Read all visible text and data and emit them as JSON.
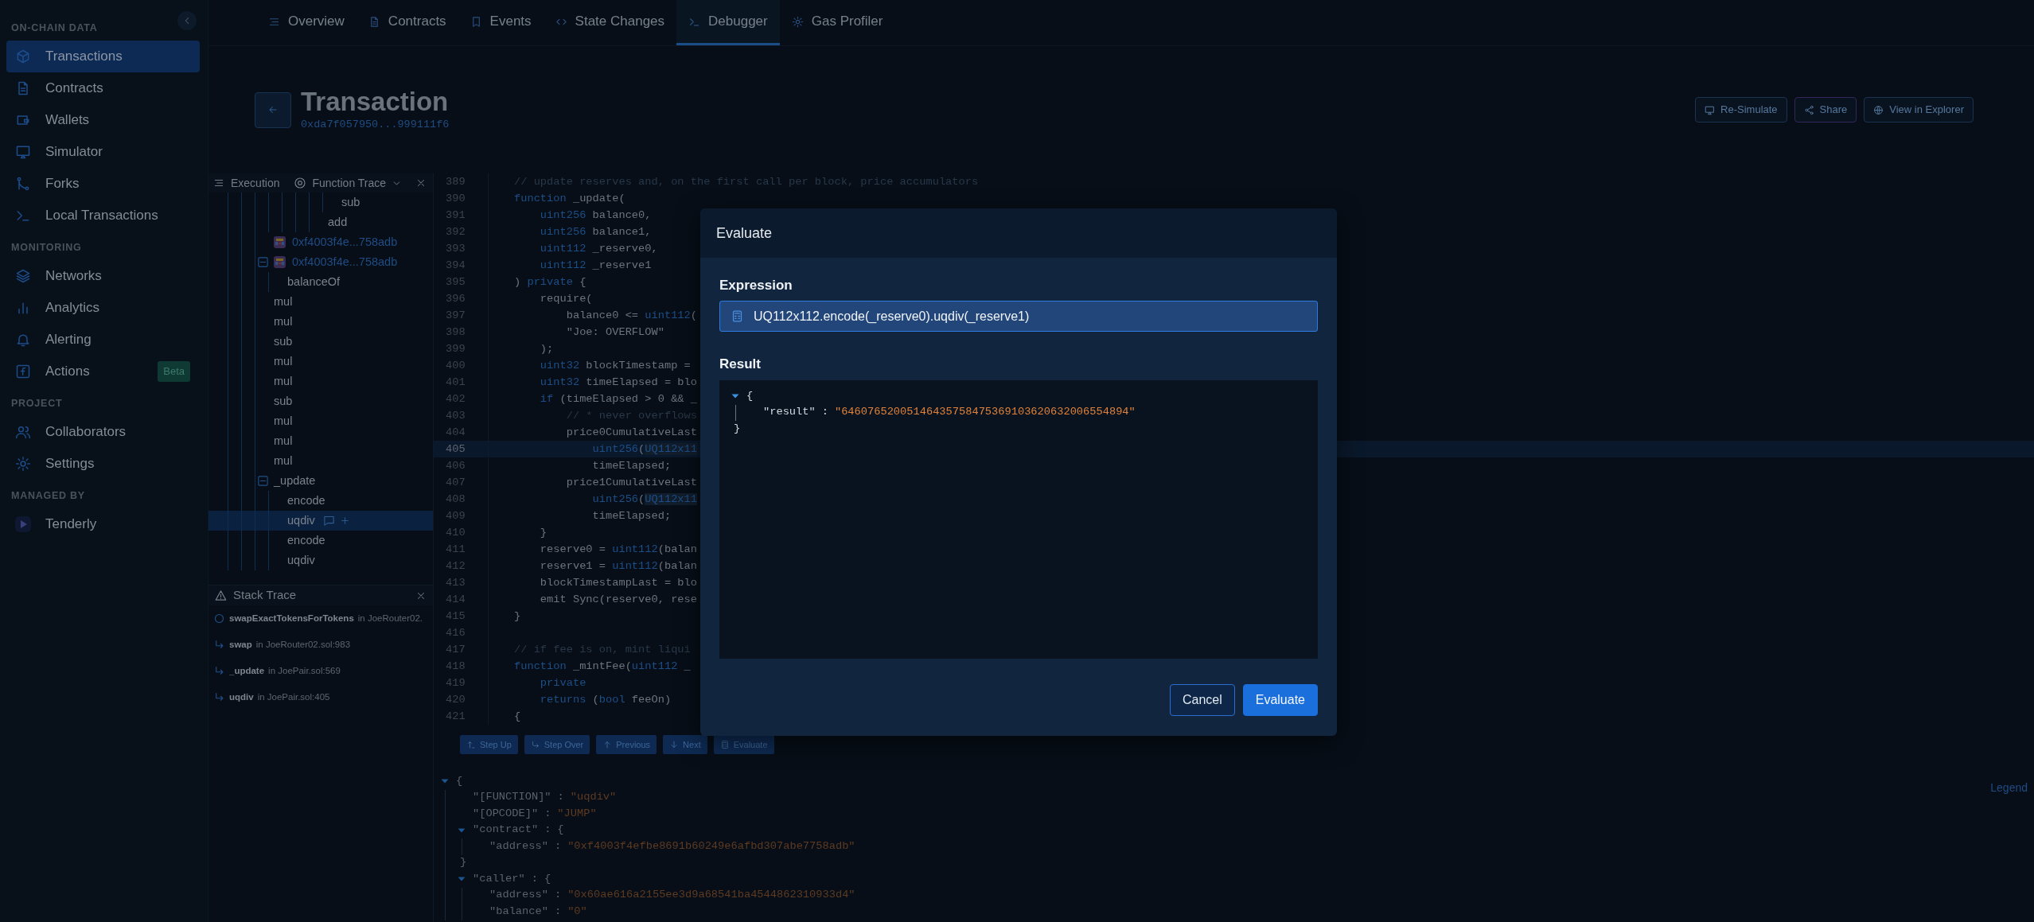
{
  "sidebar": {
    "sections": [
      {
        "title": "ON-CHAIN DATA",
        "items": [
          {
            "label": "Transactions",
            "selected": true
          },
          {
            "label": "Contracts",
            "selected": false
          },
          {
            "label": "Wallets",
            "selected": false
          },
          {
            "label": "Simulator",
            "selected": false
          },
          {
            "label": "Forks",
            "selected": false
          },
          {
            "label": "Local Transactions",
            "selected": false
          }
        ]
      },
      {
        "title": "MONITORING",
        "items": [
          {
            "label": "Networks",
            "selected": false
          },
          {
            "label": "Analytics",
            "selected": false
          },
          {
            "label": "Alerting",
            "selected": false
          },
          {
            "label": "Actions",
            "selected": false,
            "badge": "Beta"
          }
        ]
      },
      {
        "title": "PROJECT",
        "items": [
          {
            "label": "Collaborators",
            "selected": false
          },
          {
            "label": "Settings",
            "selected": false
          }
        ]
      },
      {
        "title": "MANAGED BY",
        "items": [
          {
            "label": "Tenderly",
            "selected": false
          }
        ]
      }
    ]
  },
  "tabs": [
    {
      "label": "Overview",
      "selected": false
    },
    {
      "label": "Contracts",
      "selected": false
    },
    {
      "label": "Events",
      "selected": false
    },
    {
      "label": "State Changes",
      "selected": false
    },
    {
      "label": "Debugger",
      "selected": true
    },
    {
      "label": "Gas Profiler",
      "selected": false
    }
  ],
  "header": {
    "title": "Transaction",
    "hash": "0xda7f057950...999111f6",
    "actions": [
      {
        "label": "Re-Simulate",
        "kind": "default"
      },
      {
        "label": "Share",
        "kind": "accent"
      },
      {
        "label": "View in Explorer",
        "kind": "default"
      }
    ]
  },
  "execution_panel": {
    "title": "Execution",
    "view_select": "Function Trace",
    "trace": [
      {
        "children": [
          {
            "children": [
              {
                "children": [
                  {
                    "children": [
                      {
                        "children": [
                          {
                            "kind": "call",
                            "label": "sub",
                            "selected": false
                          }
                        ]
                      },
                      {
                        "kind": "call",
                        "label": "add",
                        "selected": false
                      }
                    ]
                  }
                ]
              }
            ]
          }
        ]
      },
      {
        "kind": "contract",
        "label": "0xf4003f4e...758adb",
        "selected": false
      },
      {
        "kind": "contract",
        "label": "0xf4003f4e...758adb",
        "selected": false,
        "expanded": true,
        "children": [
          {
            "kind": "call",
            "label": "balanceOf",
            "selected": false
          }
        ]
      },
      {
        "kind": "call",
        "label": "mul",
        "selected": false
      },
      {
        "kind": "call",
        "label": "mul",
        "selected": false
      },
      {
        "kind": "call",
        "label": "sub",
        "selected": false
      },
      {
        "kind": "call",
        "label": "mul",
        "selected": false
      },
      {
        "kind": "call",
        "label": "mul",
        "selected": false
      },
      {
        "kind": "call",
        "label": "sub",
        "selected": false
      },
      {
        "kind": "call",
        "label": "mul",
        "selected": false
      },
      {
        "kind": "call",
        "label": "mul",
        "selected": false
      },
      {
        "kind": "call",
        "label": "mul",
        "selected": false
      },
      {
        "kind": "call",
        "label": "_update",
        "selected": false,
        "expanded": true,
        "children": [
          {
            "kind": "call",
            "label": "encode",
            "selected": false
          },
          {
            "kind": "call",
            "label": "uqdiv",
            "selected": true
          },
          {
            "kind": "call",
            "label": "encode",
            "selected": false
          },
          {
            "kind": "call",
            "label": "uqdiv",
            "selected": false
          }
        ]
      }
    ]
  },
  "stack_trace": {
    "title": "Stack Trace",
    "frames": [
      {
        "kind": "origin",
        "function": "swapExactTokensForTokens",
        "location": "in JoeRouter02."
      },
      {
        "kind": "call",
        "function": "swap",
        "location": "in JoeRouter02.sol:983"
      },
      {
        "kind": "call",
        "function": "_update",
        "location": "in JoePair.sol:569"
      },
      {
        "kind": "call",
        "function": "uqdiv",
        "location": "in JoePair.sol:405"
      }
    ]
  },
  "source": {
    "lines": [
      {
        "number": "389",
        "selected": false,
        "spans": [
          {
            "kind": "comment",
            "text": "// update reserves and, on the first call per block, price accumulators"
          }
        ]
      },
      {
        "number": "390",
        "selected": false,
        "spans": [
          {
            "kind": "keyword",
            "text": "function"
          },
          {
            "kind": "plain",
            "text": " _update("
          }
        ]
      },
      {
        "number": "391",
        "selected": false,
        "spans": [
          {
            "kind": "keyword",
            "text": "    uint256"
          },
          {
            "kind": "plain",
            "text": " balance0,"
          }
        ]
      },
      {
        "number": "392",
        "selected": false,
        "spans": [
          {
            "kind": "keyword",
            "text": "    uint256"
          },
          {
            "kind": "plain",
            "text": " balance1,"
          }
        ]
      },
      {
        "number": "393",
        "selected": false,
        "spans": [
          {
            "kind": "keyword",
            "text": "    uint112"
          },
          {
            "kind": "plain",
            "text": " _reserve0,"
          }
        ]
      },
      {
        "number": "394",
        "selected": false,
        "spans": [
          {
            "kind": "keyword",
            "text": "    uint112"
          },
          {
            "kind": "plain",
            "text": " _reserve1"
          }
        ]
      },
      {
        "number": "395",
        "selected": false,
        "spans": [
          {
            "kind": "plain",
            "text": ") "
          },
          {
            "kind": "keyword",
            "text": "private"
          },
          {
            "kind": "plain",
            "text": " {"
          }
        ]
      },
      {
        "number": "396",
        "selected": false,
        "spans": [
          {
            "kind": "plain",
            "text": "    require("
          }
        ]
      },
      {
        "number": "397",
        "selected": false,
        "spans": [
          {
            "kind": "plain",
            "text": "        balance0 <= "
          },
          {
            "kind": "keyword",
            "text": "uint112"
          },
          {
            "kind": "plain",
            "text": "("
          }
        ]
      },
      {
        "number": "398",
        "selected": false,
        "spans": [
          {
            "kind": "plain",
            "text": "        \"Joe: OVERFLOW\""
          }
        ]
      },
      {
        "number": "399",
        "selected": false,
        "spans": [
          {
            "kind": "plain",
            "text": "    );"
          }
        ]
      },
      {
        "number": "400",
        "selected": false,
        "spans": [
          {
            "kind": "keyword",
            "text": "    uint32"
          },
          {
            "kind": "plain",
            "text": " blockTimestamp ="
          }
        ]
      },
      {
        "number": "401",
        "selected": false,
        "spans": [
          {
            "kind": "keyword",
            "text": "    uint32"
          },
          {
            "kind": "plain",
            "text": " timeElapsed = blo"
          }
        ]
      },
      {
        "number": "402",
        "selected": false,
        "spans": [
          {
            "kind": "keyword",
            "text": "    if"
          },
          {
            "kind": "plain",
            "text": " (timeElapsed > 0 && _"
          }
        ]
      },
      {
        "number": "403",
        "selected": false,
        "spans": [
          {
            "kind": "comment",
            "text": "        // * never overflows"
          }
        ]
      },
      {
        "number": "404",
        "selected": false,
        "spans": [
          {
            "kind": "plain",
            "text": "        price0CumulativeLast"
          }
        ]
      },
      {
        "number": "405",
        "selected": true,
        "spans": [
          {
            "kind": "keyword",
            "text": "            uint256"
          },
          {
            "kind": "plain",
            "text": "("
          },
          {
            "kind": "match",
            "text": "UQ112x11"
          }
        ]
      },
      {
        "number": "406",
        "selected": false,
        "spans": [
          {
            "kind": "plain",
            "text": "            timeElapsed;"
          }
        ]
      },
      {
        "number": "407",
        "selected": false,
        "spans": [
          {
            "kind": "plain",
            "text": "        price1CumulativeLast"
          }
        ]
      },
      {
        "number": "408",
        "selected": false,
        "spans": [
          {
            "kind": "keyword",
            "text": "            uint256"
          },
          {
            "kind": "plain",
            "text": "("
          },
          {
            "kind": "match",
            "text": "UQ112x11"
          }
        ]
      },
      {
        "number": "409",
        "selected": false,
        "spans": [
          {
            "kind": "plain",
            "text": "            timeElapsed;"
          }
        ]
      },
      {
        "number": "410",
        "selected": false,
        "spans": [
          {
            "kind": "plain",
            "text": "    }"
          }
        ]
      },
      {
        "number": "411",
        "selected": false,
        "spans": [
          {
            "kind": "plain",
            "text": "    reserve0 = "
          },
          {
            "kind": "keyword",
            "text": "uint112"
          },
          {
            "kind": "plain",
            "text": "(balan"
          }
        ]
      },
      {
        "number": "412",
        "selected": false,
        "spans": [
          {
            "kind": "plain",
            "text": "    reserve1 = "
          },
          {
            "kind": "keyword",
            "text": "uint112"
          },
          {
            "kind": "plain",
            "text": "(balan"
          }
        ]
      },
      {
        "number": "413",
        "selected": false,
        "spans": [
          {
            "kind": "plain",
            "text": "    blockTimestampLast = blo"
          }
        ]
      },
      {
        "number": "414",
        "selected": false,
        "spans": [
          {
            "kind": "plain",
            "text": "    emit Sync(reserve0, rese"
          }
        ]
      },
      {
        "number": "415",
        "selected": false,
        "spans": [
          {
            "kind": "plain",
            "text": "}"
          }
        ]
      },
      {
        "number": "416",
        "selected": false
      },
      {
        "number": "417",
        "selected": false,
        "spans": [
          {
            "kind": "comment",
            "text": "// if fee is on, mint liqui"
          }
        ]
      },
      {
        "number": "418",
        "selected": false,
        "spans": [
          {
            "kind": "keyword",
            "text": "function"
          },
          {
            "kind": "plain",
            "text": " _mintFee("
          },
          {
            "kind": "keyword",
            "text": "uint112"
          },
          {
            "kind": "plain",
            "text": " _"
          }
        ]
      },
      {
        "number": "419",
        "selected": false,
        "spans": [
          {
            "kind": "keyword",
            "text": "    private"
          }
        ]
      },
      {
        "number": "420",
        "selected": false,
        "spans": [
          {
            "kind": "keyword",
            "text": "    returns"
          },
          {
            "kind": "plain",
            "text": " ("
          },
          {
            "kind": "keyword",
            "text": "bool"
          },
          {
            "kind": "plain",
            "text": " feeOn)"
          }
        ]
      },
      {
        "number": "421",
        "selected": false,
        "spans": [
          {
            "kind": "plain",
            "text": "{"
          }
        ]
      }
    ]
  },
  "debugger_buttons": [
    "Step Up",
    "Step Over",
    "Previous",
    "Next",
    "Evaluate"
  ],
  "state": {
    "legend": "Legend",
    "tree": {
      "open": "{",
      "expanded": true,
      "children": [
        {
          "key": "\"[FUNCTION]\"",
          "sep": ":",
          "value": "\"uqdiv\""
        },
        {
          "key": "\"[OPCODE]\"",
          "sep": ":",
          "value": "\"JUMP\""
        },
        {
          "key": "\"contract\"",
          "sep": ":",
          "open": "{",
          "expanded": true,
          "children": [
            {
              "key": "\"address\"",
              "sep": ":",
              "value": "\"0xf4003f4efbe8691b60249e6afbd307abe7758adb\""
            }
          ],
          "close": "}"
        },
        {
          "key": "\"caller\"",
          "sep": ":",
          "open": "{",
          "expanded": true,
          "children": [
            {
              "key": "\"address\"",
              "sep": ":",
              "value": "\"0x60ae616a2155ee3d9a68541ba4544862310933d4\""
            },
            {
              "key": "\"balance\"",
              "sep": ":",
              "value": "\"0\""
            }
          ]
        }
      ]
    }
  },
  "evaluate_dialog": {
    "title": "Evaluate",
    "expression_label": "Expression",
    "expression": "UQ112x112.encode(_reserve0).uqdiv(_reserve1)",
    "result_label": "Result",
    "result": {
      "open": "{",
      "expanded": true,
      "children": [
        {
          "key": "\"result\"",
          "sep": ":",
          "value": "\"64607652005146435758475369103620632006554894\""
        }
      ],
      "close": "}"
    },
    "buttons": [
      {
        "label": "Cancel",
        "kind": "secondary"
      },
      {
        "label": "Evaluate",
        "kind": "primary"
      }
    ]
  }
}
